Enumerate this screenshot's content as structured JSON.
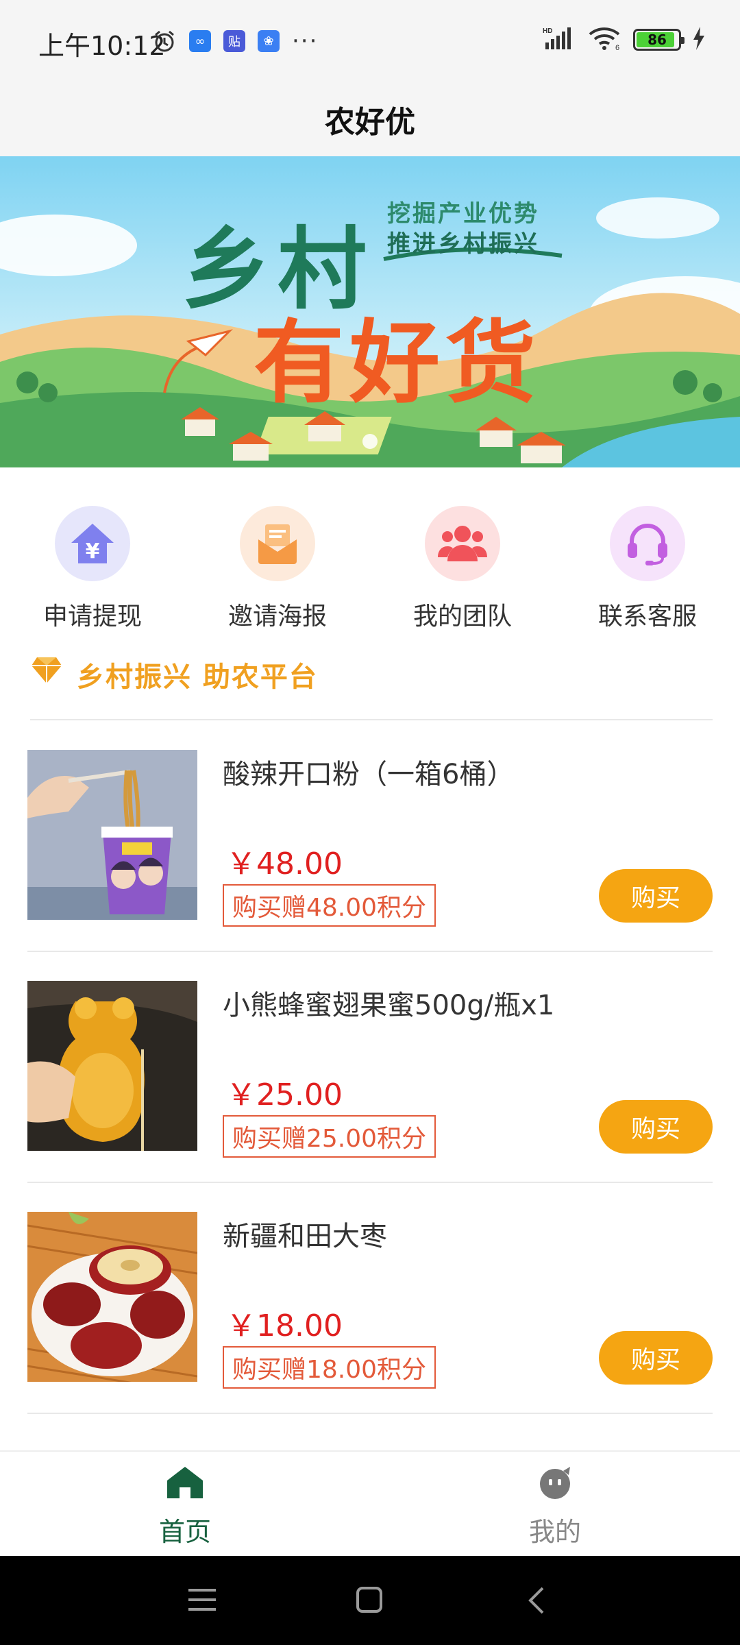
{
  "status_bar": {
    "time": "上午10:12",
    "battery": "86"
  },
  "header": {
    "title": "农好优"
  },
  "banner": {
    "line1": "乡村",
    "line2": "有好货",
    "sub1": "挖掘产业优势",
    "sub2": "推进乡村振兴"
  },
  "quick_menu": [
    {
      "label": "申请提现",
      "icon": "withdraw-house-yen-icon",
      "color": "#7f80ee",
      "bg": "#e6e6fb"
    },
    {
      "label": "邀请海报",
      "icon": "envelope-icon",
      "color": "#f59a45",
      "bg": "#fdeadb"
    },
    {
      "label": "我的团队",
      "icon": "team-people-icon",
      "color": "#f0535a",
      "bg": "#fde0e0"
    },
    {
      "label": "联系客服",
      "icon": "headset-icon",
      "color": "#c25fe0",
      "bg": "#f6e3fb"
    }
  ],
  "section": {
    "title": "乡村振兴 助农平台",
    "icon": "diamond-icon"
  },
  "products": [
    {
      "name": "酸辣开口粉（一箱6桶）",
      "price": "￥48.00",
      "points": "购买赠48.00积分",
      "buy": "购买"
    },
    {
      "name": "小熊蜂蜜翅果蜜500g/瓶x1",
      "price": "￥25.00",
      "points": "购买赠25.00积分",
      "buy": "购买"
    },
    {
      "name": "新疆和田大枣",
      "price": "￥18.00",
      "points": "购买赠18.00积分",
      "buy": "购买"
    }
  ],
  "tabs": [
    {
      "label": "首页",
      "icon": "home-icon",
      "active": true,
      "color": "#17613f"
    },
    {
      "label": "我的",
      "icon": "profile-face-icon",
      "active": false,
      "color": "#888888"
    }
  ],
  "colors": {
    "accent_orange": "#f5a512",
    "price_red": "#e02020",
    "brand_green": "#17613f"
  }
}
